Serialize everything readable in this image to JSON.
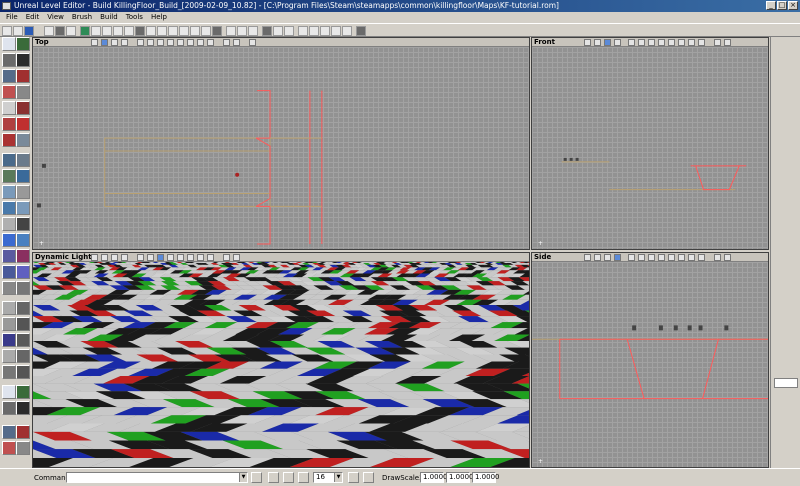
{
  "window": {
    "title": "Unreal Level Editor - Build KillingFloor_Build_[2009-02-09_10.82] - [C:\\Program Files\\Steam\\steamapps\\common\\killingfloor\\Maps\\KF-tutorial.rom]"
  },
  "menu": {
    "items": [
      "File",
      "Edit",
      "View",
      "Brush",
      "Build",
      "Tools",
      "Help"
    ]
  },
  "viewports": {
    "top": {
      "label": "Top"
    },
    "front": {
      "label": "Front"
    },
    "perspective": {
      "label": "Dynamic Light"
    },
    "side": {
      "label": "Side"
    }
  },
  "statusbar": {
    "command_label": "Command",
    "command_value": "",
    "grid_size": "16",
    "drawscale_label": "DrawScale3D",
    "drawscale_x": "1.0000",
    "drawscale_y": "1.0000",
    "drawscale_z": "1.0000"
  },
  "colors": {
    "brush_red": "#ff5a5a",
    "builder_line": "#b8a070",
    "checker": [
      "#c8c8c8",
      "#1a1a1a",
      "#c02020",
      "#20a020",
      "#1a2aa8",
      "#d0d0d0"
    ]
  }
}
